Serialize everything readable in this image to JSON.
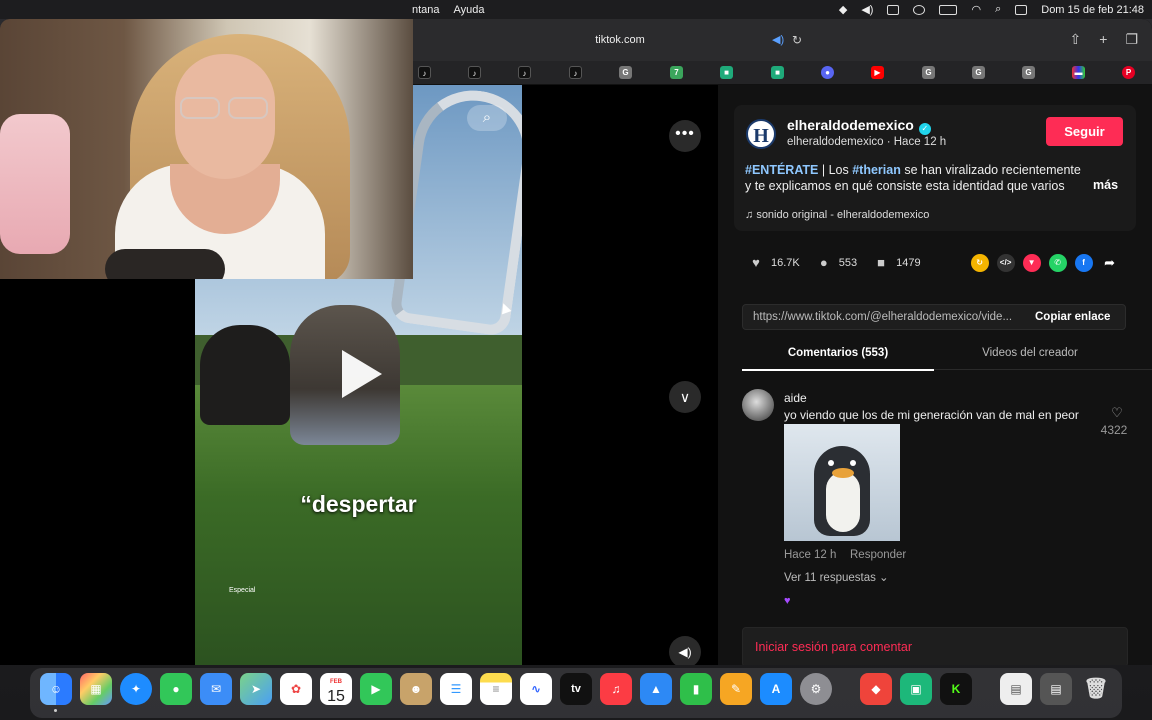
{
  "menubar": {
    "items": [
      "ntana",
      "Ayuda"
    ],
    "datetime": "Dom 15 de feb  21:48"
  },
  "browser": {
    "url": "tiktok.com"
  },
  "video": {
    "caption": "“despertar",
    "watermark": "Especial"
  },
  "post": {
    "avatar_letter": "H",
    "author": "elheraldodemexico",
    "meta": "elheraldodemexico · Hace 12 h",
    "follow_label": "Seguir",
    "desc_tag1": "#ENTÉRATE",
    "desc_part1": " | Los ",
    "desc_tag2": "#therian",
    "desc_part2": " se han viralizado recientemente y te explicamos en qué consiste esta identidad que varios",
    "more_label": "más",
    "music": "sonido original - elheraldodemexico",
    "likes": "16.7K",
    "comments": "553",
    "saves": "1479",
    "link": "https://www.tiktok.com/@elheraldodemexico/vide...",
    "copy_label": "Copiar enlace",
    "tab_comments": "Comentarios (553)",
    "tab_creator": "Videos del creador"
  },
  "comment": {
    "user": "aide",
    "text": "yo viendo que los de mi generación van de mal en peor",
    "likes": "4322",
    "time": "Hace 12 h",
    "reply_label": "Responder",
    "replies_label": "Ver 11 respuestas"
  },
  "login_label": "Iniciar sesión para comentar",
  "dock": {
    "calendar_month": "FEB",
    "calendar_day": "15"
  },
  "colors": {
    "accent": "#fe2c55",
    "verified": "#20d5ec",
    "hashtag": "#8fc8ff"
  }
}
